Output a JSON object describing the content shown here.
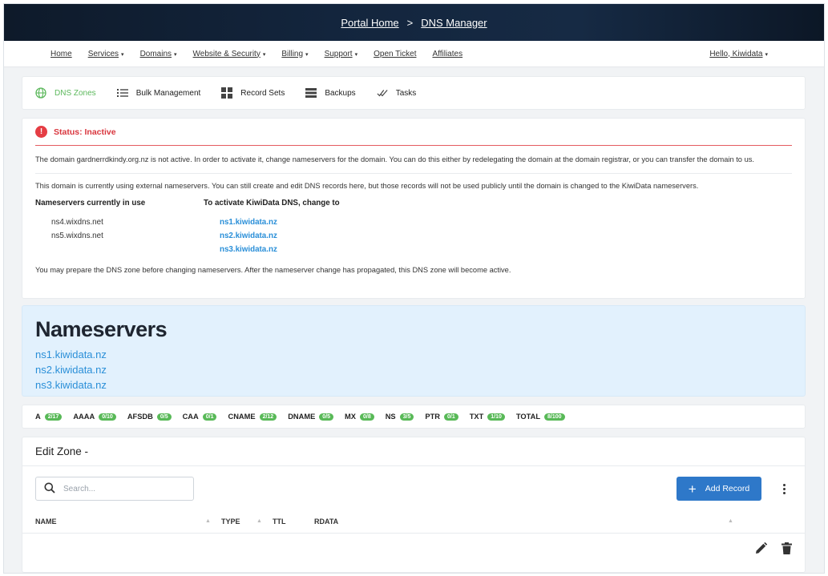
{
  "breadcrumb": {
    "home": "Portal Home",
    "separator": ">",
    "current": "DNS Manager"
  },
  "topnav": {
    "items": [
      {
        "label": "Home",
        "dropdown": false
      },
      {
        "label": "Services",
        "dropdown": true
      },
      {
        "label": "Domains",
        "dropdown": true
      },
      {
        "label": "Website & Security",
        "dropdown": true
      },
      {
        "label": "Billing",
        "dropdown": true
      },
      {
        "label": "Support",
        "dropdown": true
      },
      {
        "label": "Open Ticket",
        "dropdown": false
      },
      {
        "label": "Affiliates",
        "dropdown": false
      }
    ],
    "user": "Hello, Kiwidata",
    "caret": "▾"
  },
  "subnav": {
    "tabs": [
      {
        "label": "DNS Zones",
        "icon": "globe-icon",
        "active": true
      },
      {
        "label": "Bulk Management",
        "icon": "list-icon",
        "active": false
      },
      {
        "label": "Record Sets",
        "icon": "grid-icon",
        "active": false
      },
      {
        "label": "Backups",
        "icon": "backup-icon",
        "active": false
      },
      {
        "label": "Tasks",
        "icon": "tasks-icon",
        "active": false
      }
    ]
  },
  "status": {
    "icon": "!",
    "label": "Status: Inactive",
    "message1": "The domain gardnerrdkindy.org.nz is not active. In order to activate it, change nameservers for the domain. You can do this either by redelegating the domain at the domain registrar, or you can transfer the domain to us.",
    "message2": "This domain is currently using external nameservers. You can still create and edit DNS records here, but those records will not be used publicly until the domain is changed to the KiwiData nameservers.",
    "current_heading": "Nameservers currently in use",
    "current_ns": [
      "ns4.wixdns.net",
      "ns5.wixdns.net"
    ],
    "target_heading": "To activate KiwiData DNS, change to",
    "target_ns": [
      "ns1.kiwidata.nz",
      "ns2.kiwidata.nz",
      "ns3.kiwidata.nz"
    ],
    "message3": "You may prepare the DNS zone before changing nameservers. After the nameserver change has propagated, this DNS zone will become active."
  },
  "nameservers": {
    "title": "Nameservers",
    "list": [
      "ns1.kiwidata.nz",
      "ns2.kiwidata.nz",
      "ns3.kiwidata.nz"
    ]
  },
  "record_counts": [
    {
      "type": "A",
      "count": "2/17"
    },
    {
      "type": "AAAA",
      "count": "0/10"
    },
    {
      "type": "AFSDB",
      "count": "0/5"
    },
    {
      "type": "CAA",
      "count": "0/1"
    },
    {
      "type": "CNAME",
      "count": "2/12"
    },
    {
      "type": "DNAME",
      "count": "0/5"
    },
    {
      "type": "MX",
      "count": "0/8"
    },
    {
      "type": "NS",
      "count": "3/5"
    },
    {
      "type": "PTR",
      "count": "0/1"
    },
    {
      "type": "TXT",
      "count": "1/10"
    },
    {
      "type": "TOTAL",
      "count": "8/100"
    }
  ],
  "zone": {
    "title": "Edit Zone -",
    "search_placeholder": "Search...",
    "add_record_label": "Add Record",
    "columns": [
      "NAME",
      "TYPE",
      "TTL",
      "RDATA"
    ]
  },
  "colors": {
    "accent_green": "#5cb85c",
    "danger_red": "#d9363e",
    "link_blue": "#2a8fd8",
    "primary_button": "#2e78c9",
    "nameserver_panel": "#e2f1fd",
    "hero_dark": "#13253d"
  }
}
